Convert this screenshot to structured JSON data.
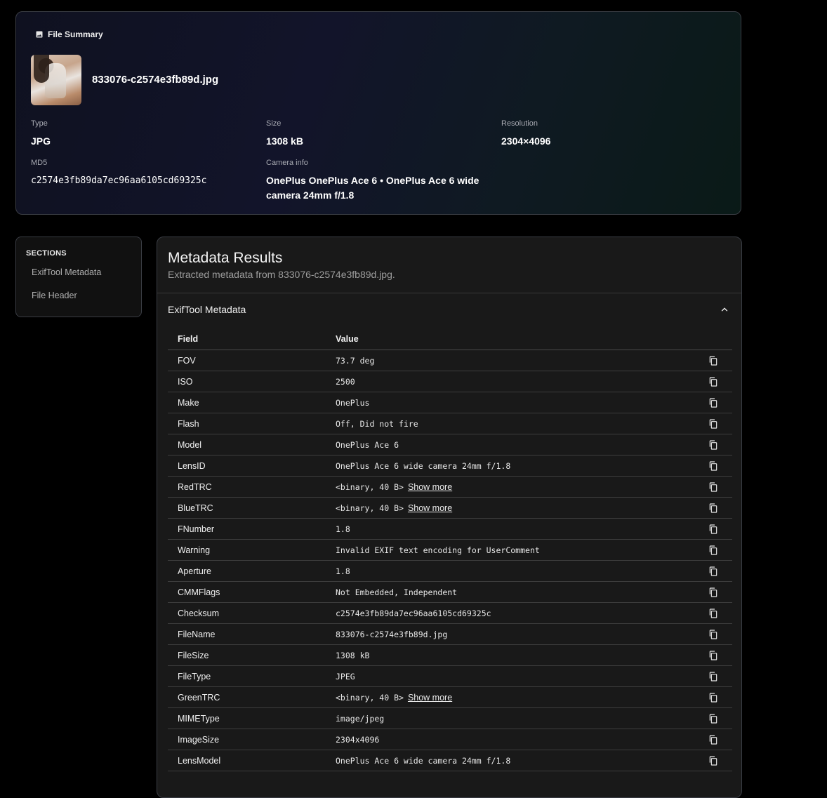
{
  "summary": {
    "header": "File Summary",
    "file_name": "833076-c2574e3fb89d.jpg",
    "type_label": "Type",
    "type_value": "JPG",
    "size_label": "Size",
    "size_value": "1308 kB",
    "resolution_label": "Resolution",
    "resolution_value": "2304×4096",
    "md5_label": "MD5",
    "md5_value": "c2574e3fb89da7ec96aa6105cd69325c",
    "camera_label": "Camera info",
    "camera_value": "OnePlus OnePlus Ace 6 • OnePlus Ace 6 wide camera 24mm f/1.8"
  },
  "sections": {
    "title": "SECTIONS",
    "items": [
      "ExifTool Metadata",
      "File Header"
    ]
  },
  "results": {
    "title": "Metadata Results",
    "subtitle": "Extracted metadata from 833076-c2574e3fb89d.jpg.",
    "accordion_title": "ExifTool Metadata",
    "col_field": "Field",
    "col_value": "Value",
    "show_more_label": "Show more",
    "rows": [
      {
        "field": "FOV",
        "value": "73.7 deg"
      },
      {
        "field": "ISO",
        "value": "2500"
      },
      {
        "field": "Make",
        "value": "OnePlus"
      },
      {
        "field": "Flash",
        "value": "Off, Did not fire"
      },
      {
        "field": "Model",
        "value": "OnePlus Ace 6"
      },
      {
        "field": "LensID",
        "value": "OnePlus Ace 6 wide camera 24mm f/1.8"
      },
      {
        "field": "RedTRC",
        "value": "<binary, 40 B>",
        "more": true
      },
      {
        "field": "BlueTRC",
        "value": "<binary, 40 B>",
        "more": true
      },
      {
        "field": "FNumber",
        "value": "1.8"
      },
      {
        "field": "Warning",
        "value": "Invalid EXIF text encoding for UserComment"
      },
      {
        "field": "Aperture",
        "value": "1.8"
      },
      {
        "field": "CMMFlags",
        "value": "Not Embedded, Independent"
      },
      {
        "field": "Checksum",
        "value": "c2574e3fb89da7ec96aa6105cd69325c"
      },
      {
        "field": "FileName",
        "value": "833076-c2574e3fb89d.jpg"
      },
      {
        "field": "FileSize",
        "value": "1308 kB"
      },
      {
        "field": "FileType",
        "value": "JPEG"
      },
      {
        "field": "GreenTRC",
        "value": "<binary, 40 B>",
        "more": true
      },
      {
        "field": "MIMEType",
        "value": "image/jpeg"
      },
      {
        "field": "ImageSize",
        "value": "2304x4096"
      },
      {
        "field": "LensModel",
        "value": "OnePlus Ace 6 wide camera 24mm f/1.8"
      }
    ]
  }
}
